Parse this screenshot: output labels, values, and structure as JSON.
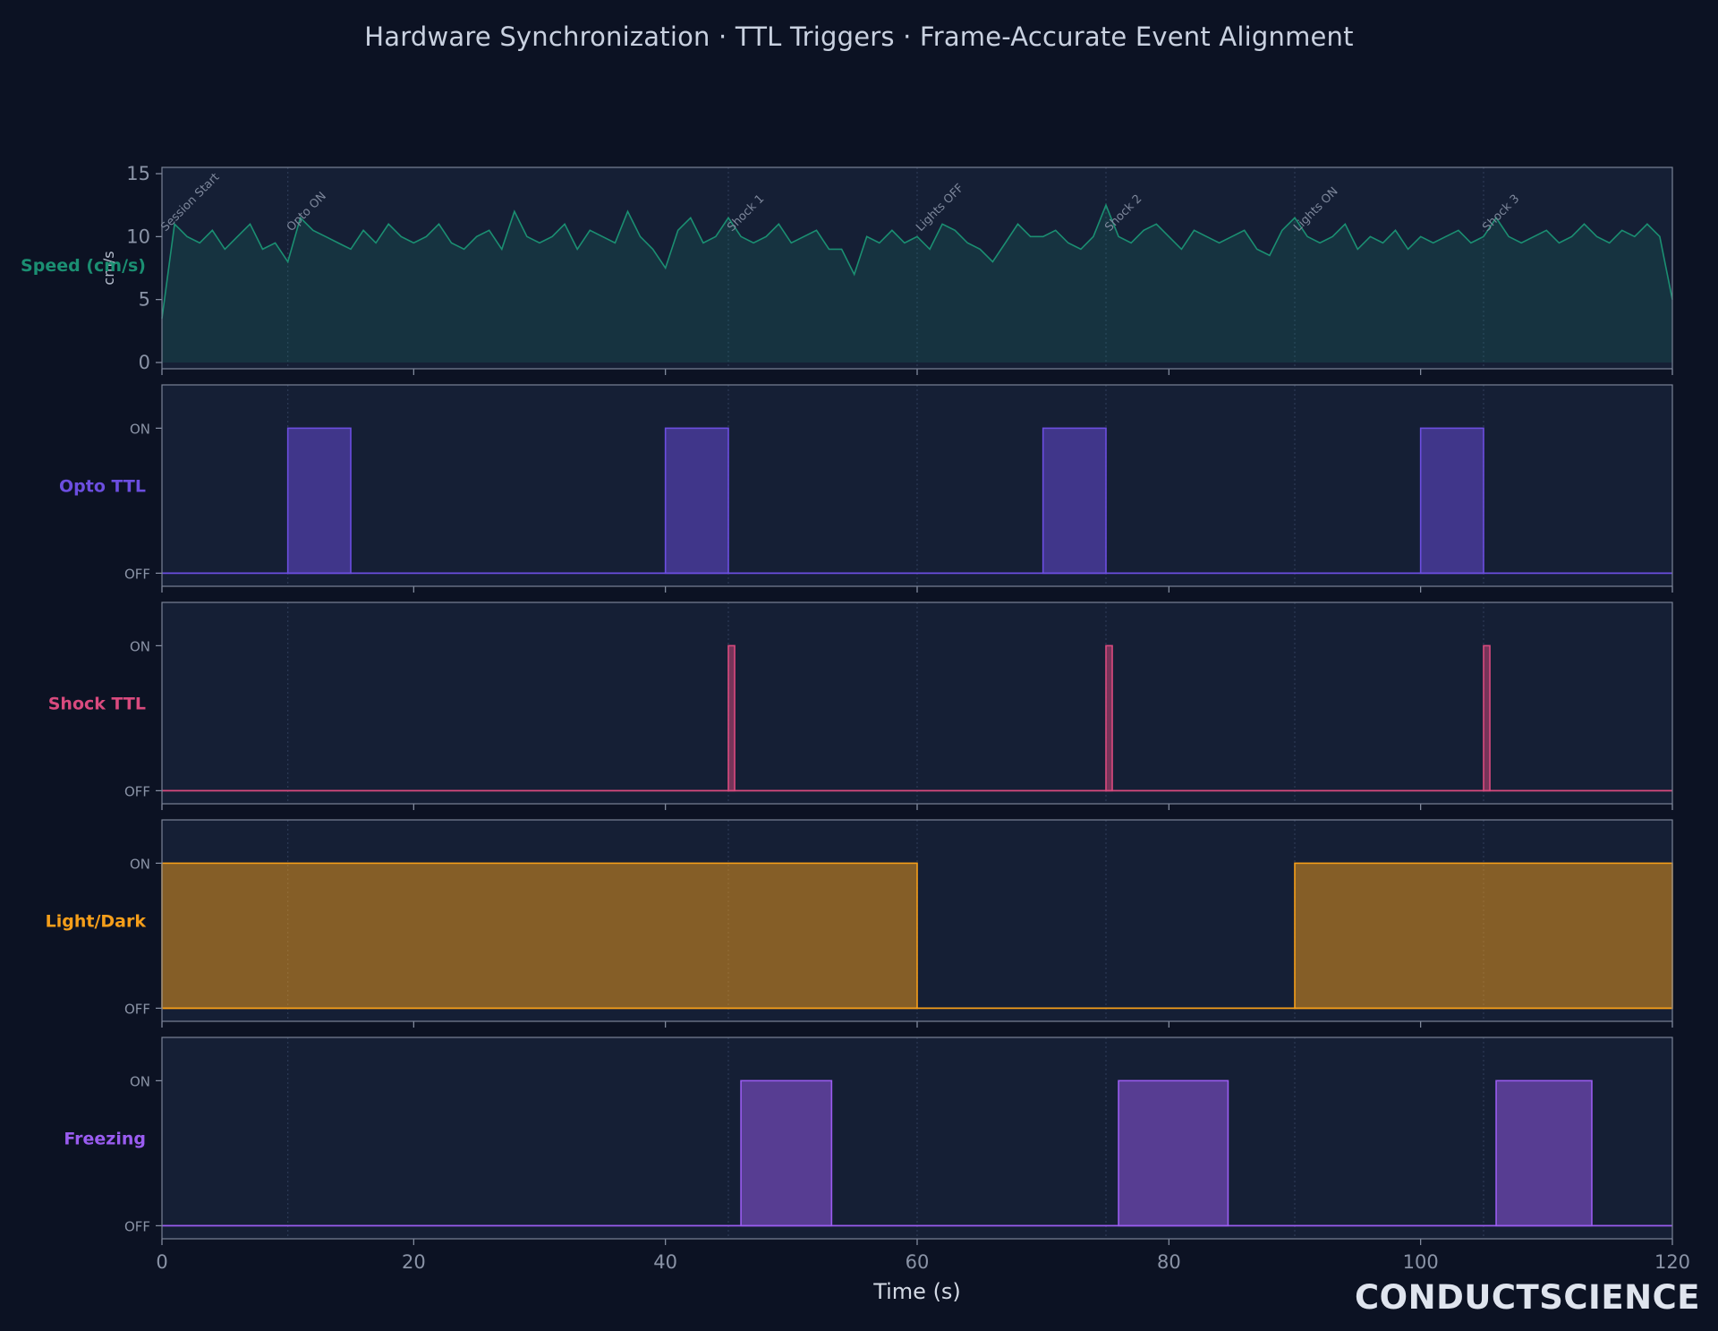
{
  "page": {
    "title": "Hardware Synchronization · TTL Triggers · Frame-Accurate Event Alignment",
    "brand": "CONDUCTSCIENCE"
  },
  "colors": {
    "background": "#0c1223",
    "panel": "#151f35",
    "speed": "#1b8f72",
    "opto": "#6c4ee0",
    "shock": "#d94a7e",
    "light": "#f59e1a",
    "freezing": "#9a5cf0",
    "text": "#c9d1e0",
    "muted": "#8a93a6"
  },
  "chart_data": {
    "type": "line",
    "xlabel": "Time (s)",
    "xlim": [
      0,
      120
    ],
    "x_ticks": [
      0,
      20,
      40,
      60,
      80,
      100,
      120
    ],
    "events": [
      {
        "t": 0,
        "label": "Session Start"
      },
      {
        "t": 10,
        "label": "Opto ON"
      },
      {
        "t": 45,
        "label": "Shock 1"
      },
      {
        "t": 60,
        "label": "Lights OFF"
      },
      {
        "t": 75,
        "label": "Shock 2"
      },
      {
        "t": 90,
        "label": "Lights ON"
      },
      {
        "t": 105,
        "label": "Shock 3"
      }
    ],
    "panels": [
      {
        "kind": "line",
        "name": "Speed (cm/s)",
        "ylabel": "cm/s",
        "ylim": [
          -0.5,
          15.5
        ],
        "yticks": [
          0,
          5,
          10,
          15
        ],
        "color": "#1b8f72",
        "series": {
          "x": [
            0,
            1,
            2,
            3,
            4,
            5,
            6,
            7,
            8,
            9,
            10,
            11,
            12,
            13,
            14,
            15,
            16,
            17,
            18,
            19,
            20,
            21,
            22,
            23,
            24,
            25,
            26,
            27,
            28,
            29,
            30,
            31,
            32,
            33,
            34,
            35,
            36,
            37,
            38,
            39,
            40,
            41,
            42,
            43,
            44,
            45,
            46,
            47,
            48,
            49,
            50,
            51,
            52,
            53,
            54,
            55,
            56,
            57,
            58,
            59,
            60,
            61,
            62,
            63,
            64,
            65,
            66,
            67,
            68,
            69,
            70,
            71,
            72,
            73,
            74,
            75,
            76,
            77,
            78,
            79,
            80,
            81,
            82,
            83,
            84,
            85,
            86,
            87,
            88,
            89,
            90,
            91,
            92,
            93,
            94,
            95,
            96,
            97,
            98,
            99,
            100,
            101,
            102,
            103,
            104,
            105,
            106,
            107,
            108,
            109,
            110,
            111,
            112,
            113,
            114,
            115,
            116,
            117,
            118,
            119,
            120
          ],
          "y": [
            3.5,
            11.0,
            10.0,
            9.5,
            10.5,
            9.0,
            10.0,
            11.0,
            9.0,
            9.5,
            8.0,
            11.5,
            10.5,
            10.0,
            9.5,
            9.0,
            10.5,
            9.5,
            11.0,
            10.0,
            9.5,
            10.0,
            11.0,
            9.5,
            9.0,
            10.0,
            10.5,
            9.0,
            12.0,
            10.0,
            9.5,
            10.0,
            11.0,
            9.0,
            10.5,
            10.0,
            9.5,
            12.0,
            10.0,
            9.0,
            7.5,
            10.5,
            11.5,
            9.5,
            10.0,
            11.5,
            10.0,
            9.5,
            10.0,
            11.0,
            9.5,
            10.0,
            10.5,
            9.0,
            9.0,
            7.0,
            10.0,
            9.5,
            10.5,
            9.5,
            10.0,
            9.0,
            11.0,
            10.5,
            9.5,
            9.0,
            8.0,
            9.5,
            11.0,
            10.0,
            10.0,
            10.5,
            9.5,
            9.0,
            10.0,
            12.5,
            10.0,
            9.5,
            10.5,
            11.0,
            10.0,
            9.0,
            10.5,
            10.0,
            9.5,
            10.0,
            10.5,
            9.0,
            8.5,
            10.5,
            11.5,
            10.0,
            9.5,
            10.0,
            11.0,
            9.0,
            10.0,
            9.5,
            10.5,
            9.0,
            10.0,
            9.5,
            10.0,
            10.5,
            9.5,
            10.0,
            11.5,
            10.0,
            9.5,
            10.0,
            10.5,
            9.5,
            10.0,
            11.0,
            10.0,
            9.5,
            10.5,
            10.0,
            11.0,
            10.0,
            5.0
          ]
        }
      },
      {
        "kind": "ttl",
        "name": "Opto TTL",
        "color": "#6c4ee0",
        "on_label": "ON",
        "off_label": "OFF",
        "intervals": [
          [
            10,
            15
          ],
          [
            40,
            45
          ],
          [
            70,
            75
          ],
          [
            100,
            105
          ]
        ]
      },
      {
        "kind": "ttl",
        "name": "Shock TTL",
        "color": "#d94a7e",
        "on_label": "ON",
        "off_label": "OFF",
        "intervals": [
          [
            45,
            45.5
          ],
          [
            75,
            75.5
          ],
          [
            105,
            105.5
          ]
        ]
      },
      {
        "kind": "ttl",
        "name": "Light/Dark",
        "color": "#f59e1a",
        "on_label": "ON",
        "off_label": "OFF",
        "intervals": [
          [
            0,
            60
          ],
          [
            90,
            120
          ]
        ]
      },
      {
        "kind": "ttl",
        "name": "Freezing",
        "color": "#9a5cf0",
        "on_label": "ON",
        "off_label": "OFF",
        "intervals": [
          [
            46,
            53.2
          ],
          [
            76,
            84.7
          ],
          [
            106,
            113.6
          ]
        ]
      }
    ]
  }
}
